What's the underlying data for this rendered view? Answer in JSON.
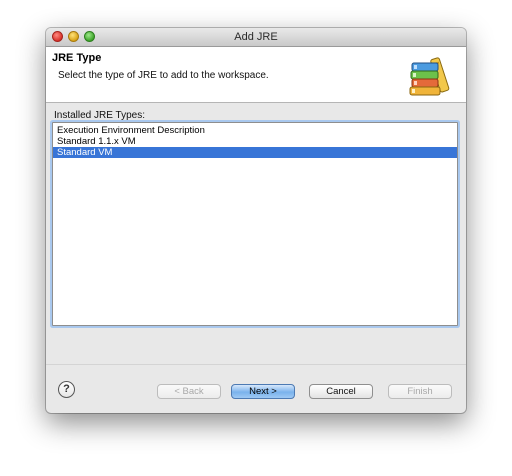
{
  "window": {
    "title": "Add JRE"
  },
  "header": {
    "title": "JRE Type",
    "description": "Select the type of JRE to add to the workspace."
  },
  "list": {
    "label": "Installed JRE Types:",
    "items": [
      {
        "label": "Execution Environment Description",
        "selected": false
      },
      {
        "label": "Standard 1.1.x VM",
        "selected": false
      },
      {
        "label": "Standard VM",
        "selected": true
      }
    ]
  },
  "buttons": {
    "back": "< Back",
    "next": "Next >",
    "cancel": "Cancel",
    "finish": "Finish",
    "help": "?"
  },
  "icons": {
    "header": "library-books-icon",
    "help": "help-icon"
  },
  "colors": {
    "selection": "#3875d7",
    "focus_ring": "#a9c8ee",
    "default_button": "#7ab2ec"
  }
}
